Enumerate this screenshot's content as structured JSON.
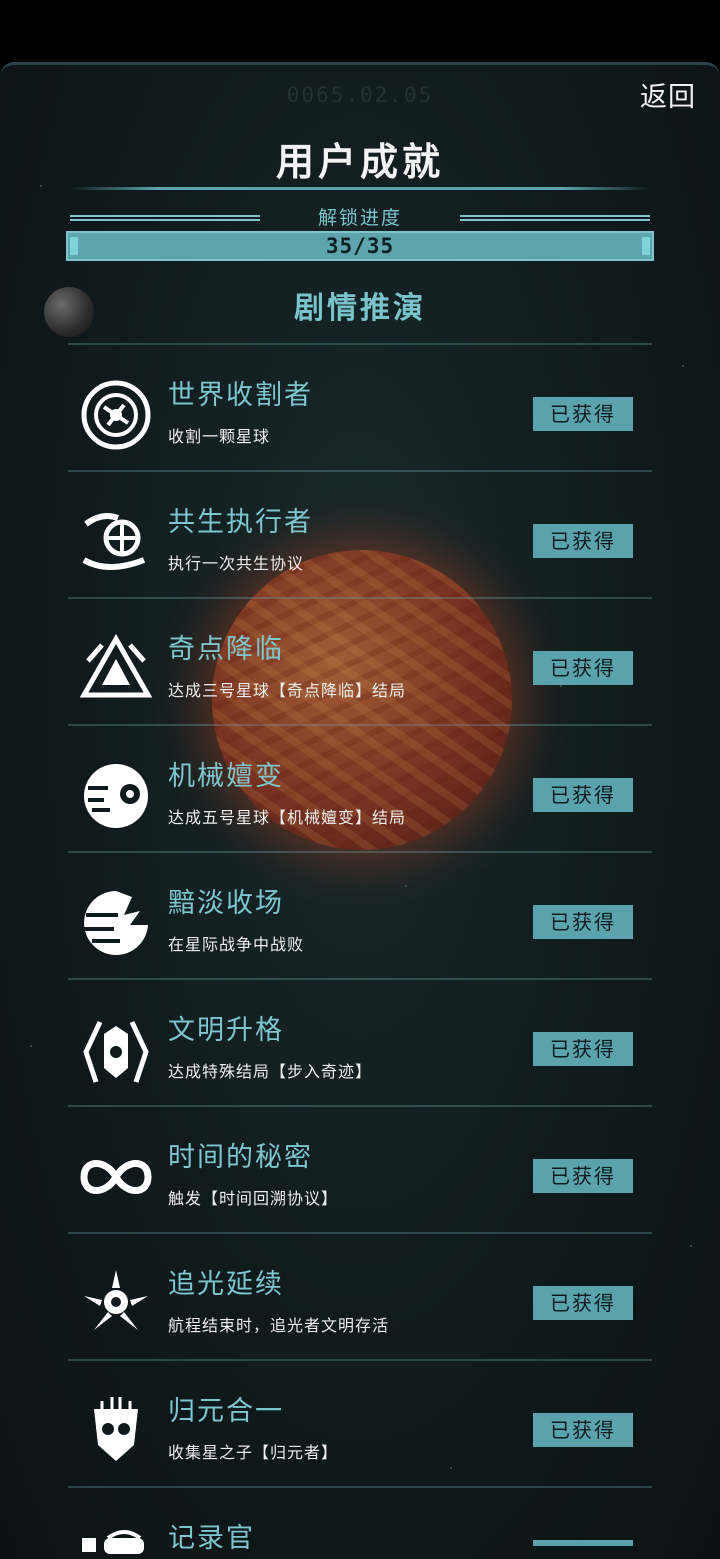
{
  "header": {
    "date_stamp": "0065.02.05",
    "back_label": "返回",
    "title": "用户成就"
  },
  "progress": {
    "label": "解锁进度",
    "count_text": "35/35",
    "fraction": 1.0
  },
  "section": {
    "title": "剧情推演"
  },
  "achievements": [
    {
      "name": "世界收割者",
      "desc": "收割一颗星球",
      "status": "已获得",
      "icon": "harvester-emblem-icon"
    },
    {
      "name": "共生执行者",
      "desc": "执行一次共生协议",
      "status": "已获得",
      "icon": "symbiosis-hands-icon"
    },
    {
      "name": "奇点降临",
      "desc": "达成三号星球【奇点降临】结局",
      "status": "已获得",
      "icon": "singularity-triangle-icon"
    },
    {
      "name": "机械嬗变",
      "desc": "达成五号星球【机械嬗变】结局",
      "status": "已获得",
      "icon": "mechanical-eye-icon"
    },
    {
      "name": "黯淡收场",
      "desc": "在星际战争中战败",
      "status": "已获得",
      "icon": "broken-planet-icon"
    },
    {
      "name": "文明升格",
      "desc": "达成特殊结局【步入奇迹】",
      "status": "已获得",
      "icon": "winged-shield-icon"
    },
    {
      "name": "时间的秘密",
      "desc": "触发【时间回溯协议】",
      "status": "已获得",
      "icon": "infinity-icon"
    },
    {
      "name": "追光延续",
      "desc": "航程结束时，追光者文明存活",
      "status": "已获得",
      "icon": "radiant-star-icon"
    },
    {
      "name": "归元合一",
      "desc": "收集星之子【归元者】",
      "status": "已获得",
      "icon": "mask-face-icon"
    },
    {
      "name": "记录官",
      "desc": "",
      "status": "",
      "icon": "recorder-icon"
    }
  ],
  "colors": {
    "accent": "#79c3cb",
    "badge_bg": "#5aa3ac",
    "panel_bg": "#101a1c"
  }
}
